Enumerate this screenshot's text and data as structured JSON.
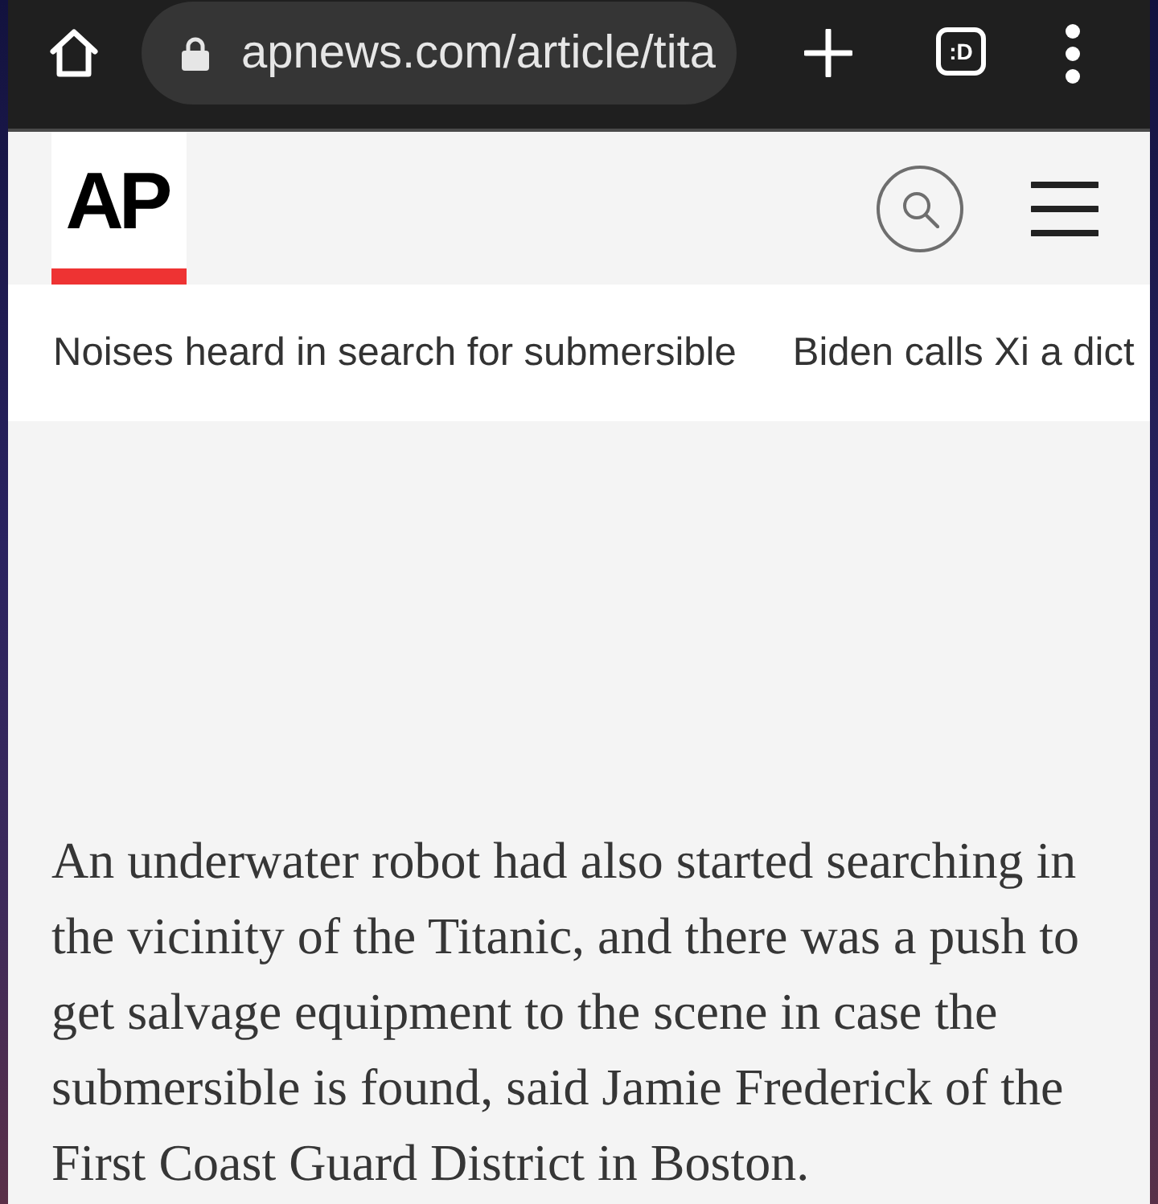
{
  "browser_toolbar": {
    "url": "apnews.com/article/tita",
    "tab_count": ":D"
  },
  "site_header": {
    "logo_text": "AP"
  },
  "nav_links": [
    "Noises heard in search for submersible",
    "Biden calls Xi a dict"
  ],
  "article": {
    "paragraph": "An underwater robot had also started searching in the vicinity of the Titanic, and there was a push to get salvage equipment to the scene in case the submersible is found, said Jamie Frederick of the First Coast Guard District in Boston."
  }
}
